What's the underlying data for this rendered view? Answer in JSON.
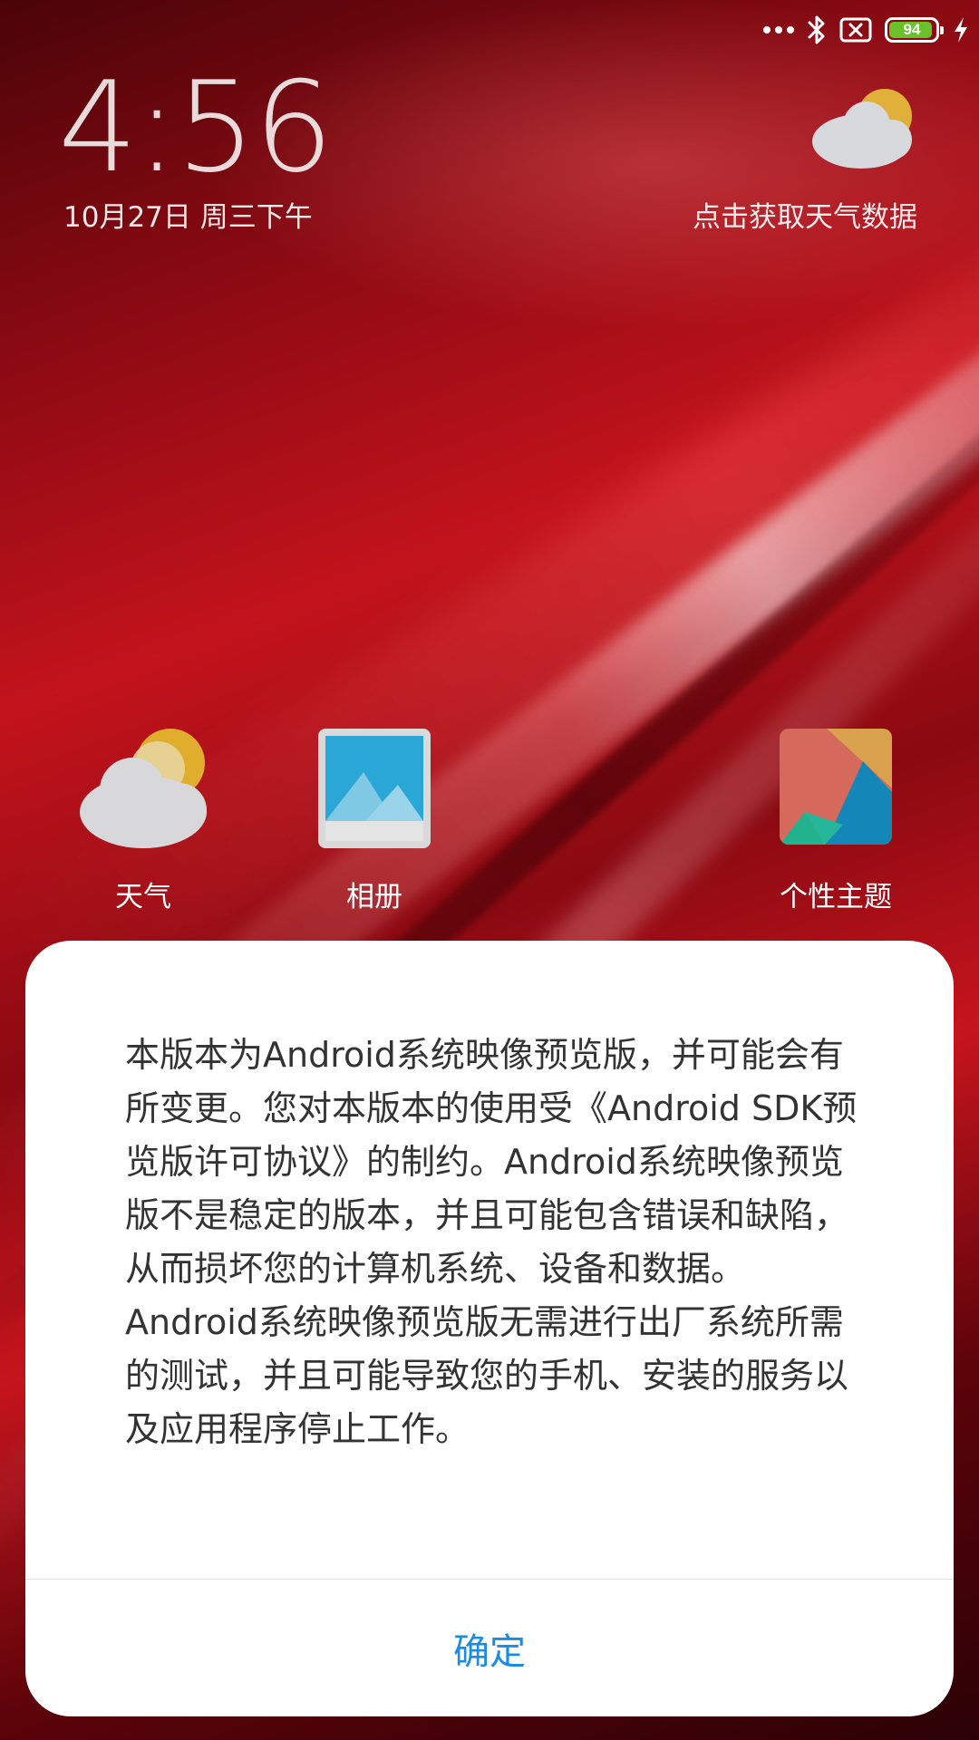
{
  "status_bar": {
    "battery_level": "94",
    "icons": [
      "signal-dots-icon",
      "bluetooth-icon",
      "sim-x-icon",
      "battery-icon",
      "charging-icon"
    ],
    "battery_color": "#6ac12b"
  },
  "lockscreen": {
    "time": "4:56",
    "date": "10月27日 周三下午",
    "weather_prompt": "点击获取天气数据",
    "weather_icon": "partly-cloudy-icon"
  },
  "apps": [
    {
      "label": "天气",
      "icon": "weather-app-icon"
    },
    {
      "label": "相册",
      "icon": "gallery-app-icon"
    },
    {
      "label": "个性主题",
      "icon": "themes-app-icon"
    }
  ],
  "dialog": {
    "message": "本版本为Android系统映像预览版，并可能会有所变更。您对本版本的使用受《Android SDK预览版许可协议》的制约。Android系统映像预览版不是稳定的版本，并且可能包含错误和缺陷，从而损坏您的计算机系统、设备和数据。Android系统映像预览版无需进行出厂系统所需的测试，并且可能导致您的手机、安装的服务以及应用程序停止工作。",
    "confirm_label": "确定",
    "accent_color": "#1b8ce0"
  }
}
